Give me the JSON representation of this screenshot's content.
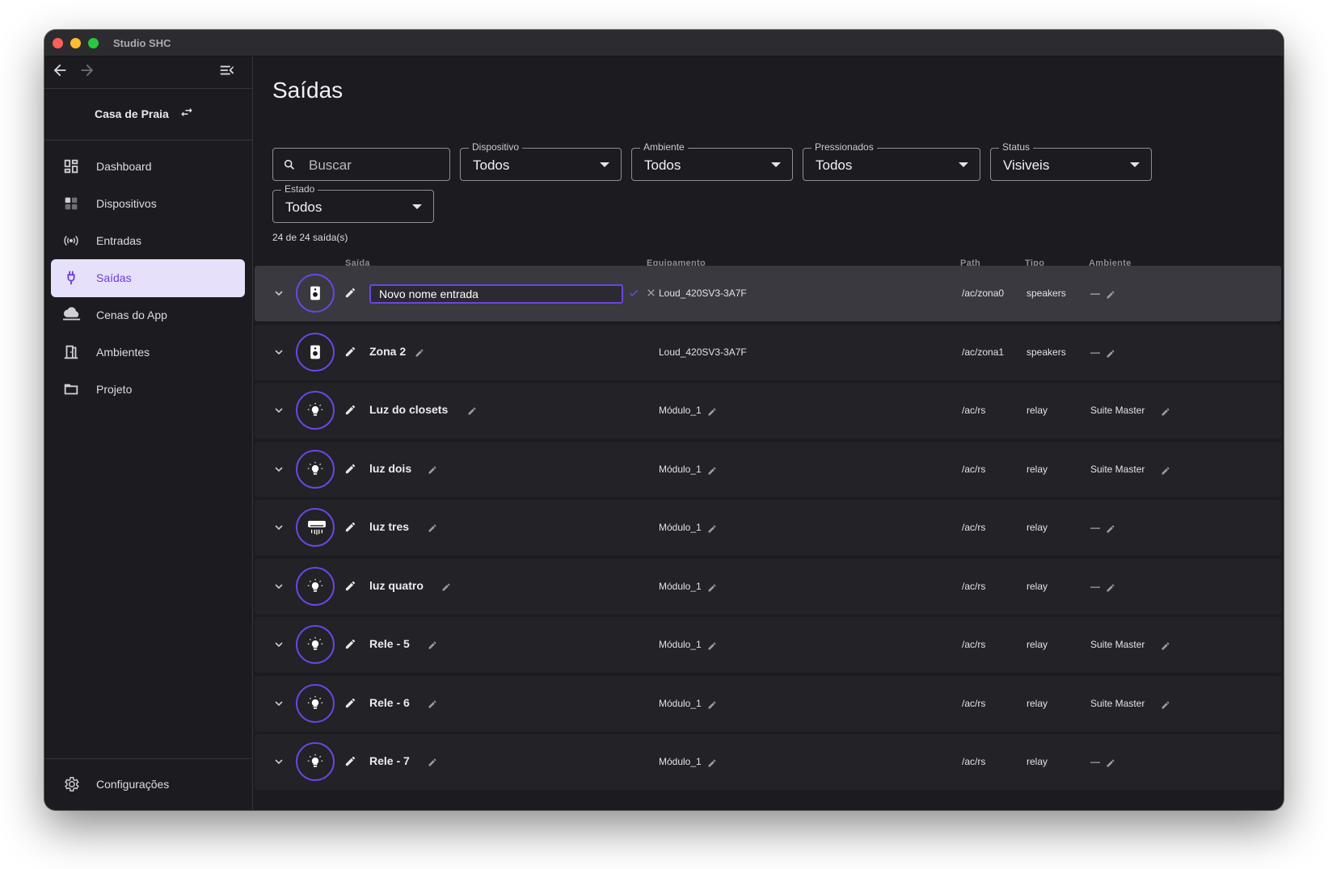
{
  "window": {
    "title": "Studio SHC"
  },
  "sidebar": {
    "project_name": "Casa de Praia",
    "items": [
      {
        "label": "Dashboard",
        "icon": "dashboard-icon",
        "active": false
      },
      {
        "label": "Dispositivos",
        "icon": "devices-icon",
        "active": false
      },
      {
        "label": "Entradas",
        "icon": "signal-icon",
        "active": false
      },
      {
        "label": "Saídas",
        "icon": "plug-icon",
        "active": true
      },
      {
        "label": "Cenas do App",
        "icon": "cloud-icon",
        "active": false
      },
      {
        "label": "Ambientes",
        "icon": "door-icon",
        "active": false
      },
      {
        "label": "Projeto",
        "icon": "folder-icon",
        "active": false
      }
    ],
    "settings_label": "Configurações"
  },
  "main": {
    "title": "Saídas",
    "search": {
      "placeholder": "Buscar"
    },
    "filters": [
      {
        "label": "Dispositivo",
        "value": "Todos"
      },
      {
        "label": "Ambiente",
        "value": "Todos"
      },
      {
        "label": "Pressionados",
        "value": "Todos"
      },
      {
        "label": "Status",
        "value": "Visiveis"
      },
      {
        "label": "Estado",
        "value": "Todos"
      }
    ],
    "count_text": "24 de 24 saída(s)",
    "columns": {
      "saida": "Saída",
      "equipamento": "Equipamento",
      "path": "Path",
      "tipo": "Tipo",
      "ambiente": "Ambiente"
    },
    "editing_value": "Novo nome entrada",
    "rows": [
      {
        "name": "Novo nome entrada",
        "icon": "speaker-icon",
        "equipment": "Loud_420SV3-3A7F",
        "path": "/ac/zona0",
        "type": "speakers",
        "ambiente": "—"
      },
      {
        "name": "Zona 2",
        "icon": "speaker-icon",
        "equipment": "Loud_420SV3-3A7F",
        "path": "/ac/zona1",
        "type": "speakers",
        "ambiente": "—"
      },
      {
        "name": "Luz do closets",
        "icon": "bulb-icon",
        "equipment": "Módulo_1",
        "path": "/ac/rs",
        "type": "relay",
        "ambiente": "Suite Master"
      },
      {
        "name": "luz dois",
        "icon": "bulb-icon",
        "equipment": "Módulo_1",
        "path": "/ac/rs",
        "type": "relay",
        "ambiente": "Suite Master"
      },
      {
        "name": "luz tres",
        "icon": "air-conditioner-icon",
        "equipment": "Módulo_1",
        "path": "/ac/rs",
        "type": "relay",
        "ambiente": "—"
      },
      {
        "name": "luz quatro",
        "icon": "bulb-icon",
        "equipment": "Módulo_1",
        "path": "/ac/rs",
        "type": "relay",
        "ambiente": "—"
      },
      {
        "name": "Rele - 5",
        "icon": "bulb-icon",
        "equipment": "Módulo_1",
        "path": "/ac/rs",
        "type": "relay",
        "ambiente": "Suite Master"
      },
      {
        "name": "Rele - 6",
        "icon": "bulb-icon",
        "equipment": "Módulo_1",
        "path": "/ac/rs",
        "type": "relay",
        "ambiente": "Suite Master"
      },
      {
        "name": "Rele - 7",
        "icon": "bulb-icon",
        "equipment": "Módulo_1",
        "path": "/ac/rs",
        "type": "relay",
        "ambiente": "—"
      }
    ]
  },
  "colors": {
    "accent": "#6b46e0",
    "active_bg": "#e6e0fb",
    "active_text": "#6b3fd8",
    "window_bg": "#1c1c20",
    "row_bg": "#222227",
    "row_editing_bg": "#39393f"
  }
}
